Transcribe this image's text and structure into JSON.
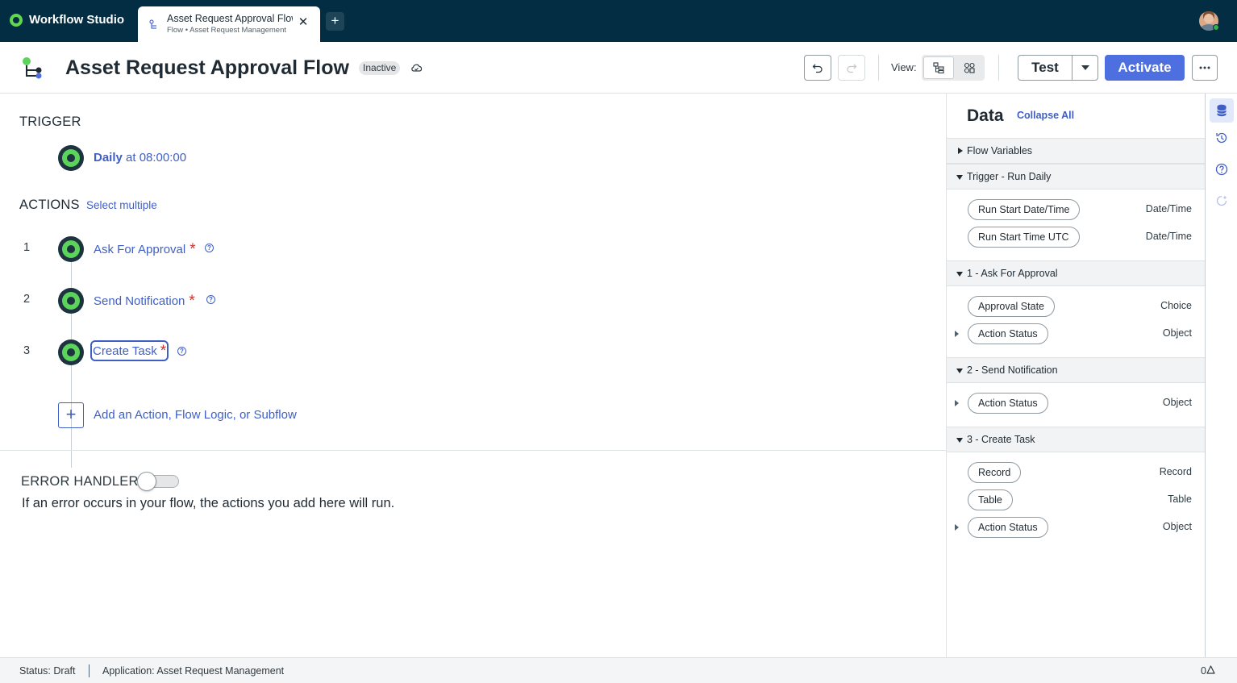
{
  "app": {
    "name": "Workflow Studio"
  },
  "tab": {
    "title": "Asset Request Approval Flow",
    "subtitle": "Flow • Asset Request Management",
    "new_tab": "+"
  },
  "header": {
    "title": "Asset Request Approval Flow",
    "status_badge": "Inactive",
    "view_label": "View:",
    "test_label": "Test",
    "activate_label": "Activate"
  },
  "trigger": {
    "section_label": "TRIGGER",
    "schedule_bold": "Daily",
    "schedule_rest": " at 08:00:00"
  },
  "actions": {
    "section_label": "ACTIONS",
    "select_multiple": "Select multiple",
    "items": [
      {
        "number": "1",
        "label": "Ask For Approval",
        "required": "*"
      },
      {
        "number": "2",
        "label": "Send Notification",
        "required": "*"
      },
      {
        "number": "3",
        "label": "Create Task",
        "required": "*"
      }
    ],
    "add_plus": "+",
    "add_label": "Add an Action, Flow Logic, or Subflow"
  },
  "error_handler": {
    "label": "ERROR HANDLER",
    "enabled": false,
    "description": "If an error occurs in your flow, the actions you add here will run."
  },
  "data_panel": {
    "title": "Data",
    "collapse_all": "Collapse All",
    "groups": [
      {
        "label": "Flow Variables",
        "expanded": false,
        "pills": []
      },
      {
        "label": "Trigger - Run Daily",
        "expanded": true,
        "pills": [
          {
            "label": "Run Start Date/Time",
            "type": "Date/Time"
          },
          {
            "label": "Run Start Time UTC",
            "type": "Date/Time"
          }
        ]
      },
      {
        "label": "1 - Ask For Approval",
        "expanded": true,
        "pills": [
          {
            "label": "Approval State",
            "type": "Choice"
          },
          {
            "label": "Action Status",
            "type": "Object"
          }
        ]
      },
      {
        "label": "2 - Send Notification",
        "expanded": true,
        "pills": [
          {
            "label": "Action Status",
            "type": "Object"
          }
        ]
      },
      {
        "label": "3 - Create Task",
        "expanded": true,
        "pills": [
          {
            "label": "Record",
            "type": "Record"
          },
          {
            "label": "Table",
            "type": "Table"
          },
          {
            "label": "Action Status",
            "type": "Object"
          }
        ]
      }
    ]
  },
  "status_bar": {
    "status": "Status: Draft",
    "application": "Application: Asset Request Management",
    "notification_count": "0"
  },
  "colors": {
    "topbar": "#032d42",
    "accent": "#4d6fe0",
    "link": "#3f5fc5",
    "node_green": "#5cd35a",
    "required": "#d0322e"
  }
}
